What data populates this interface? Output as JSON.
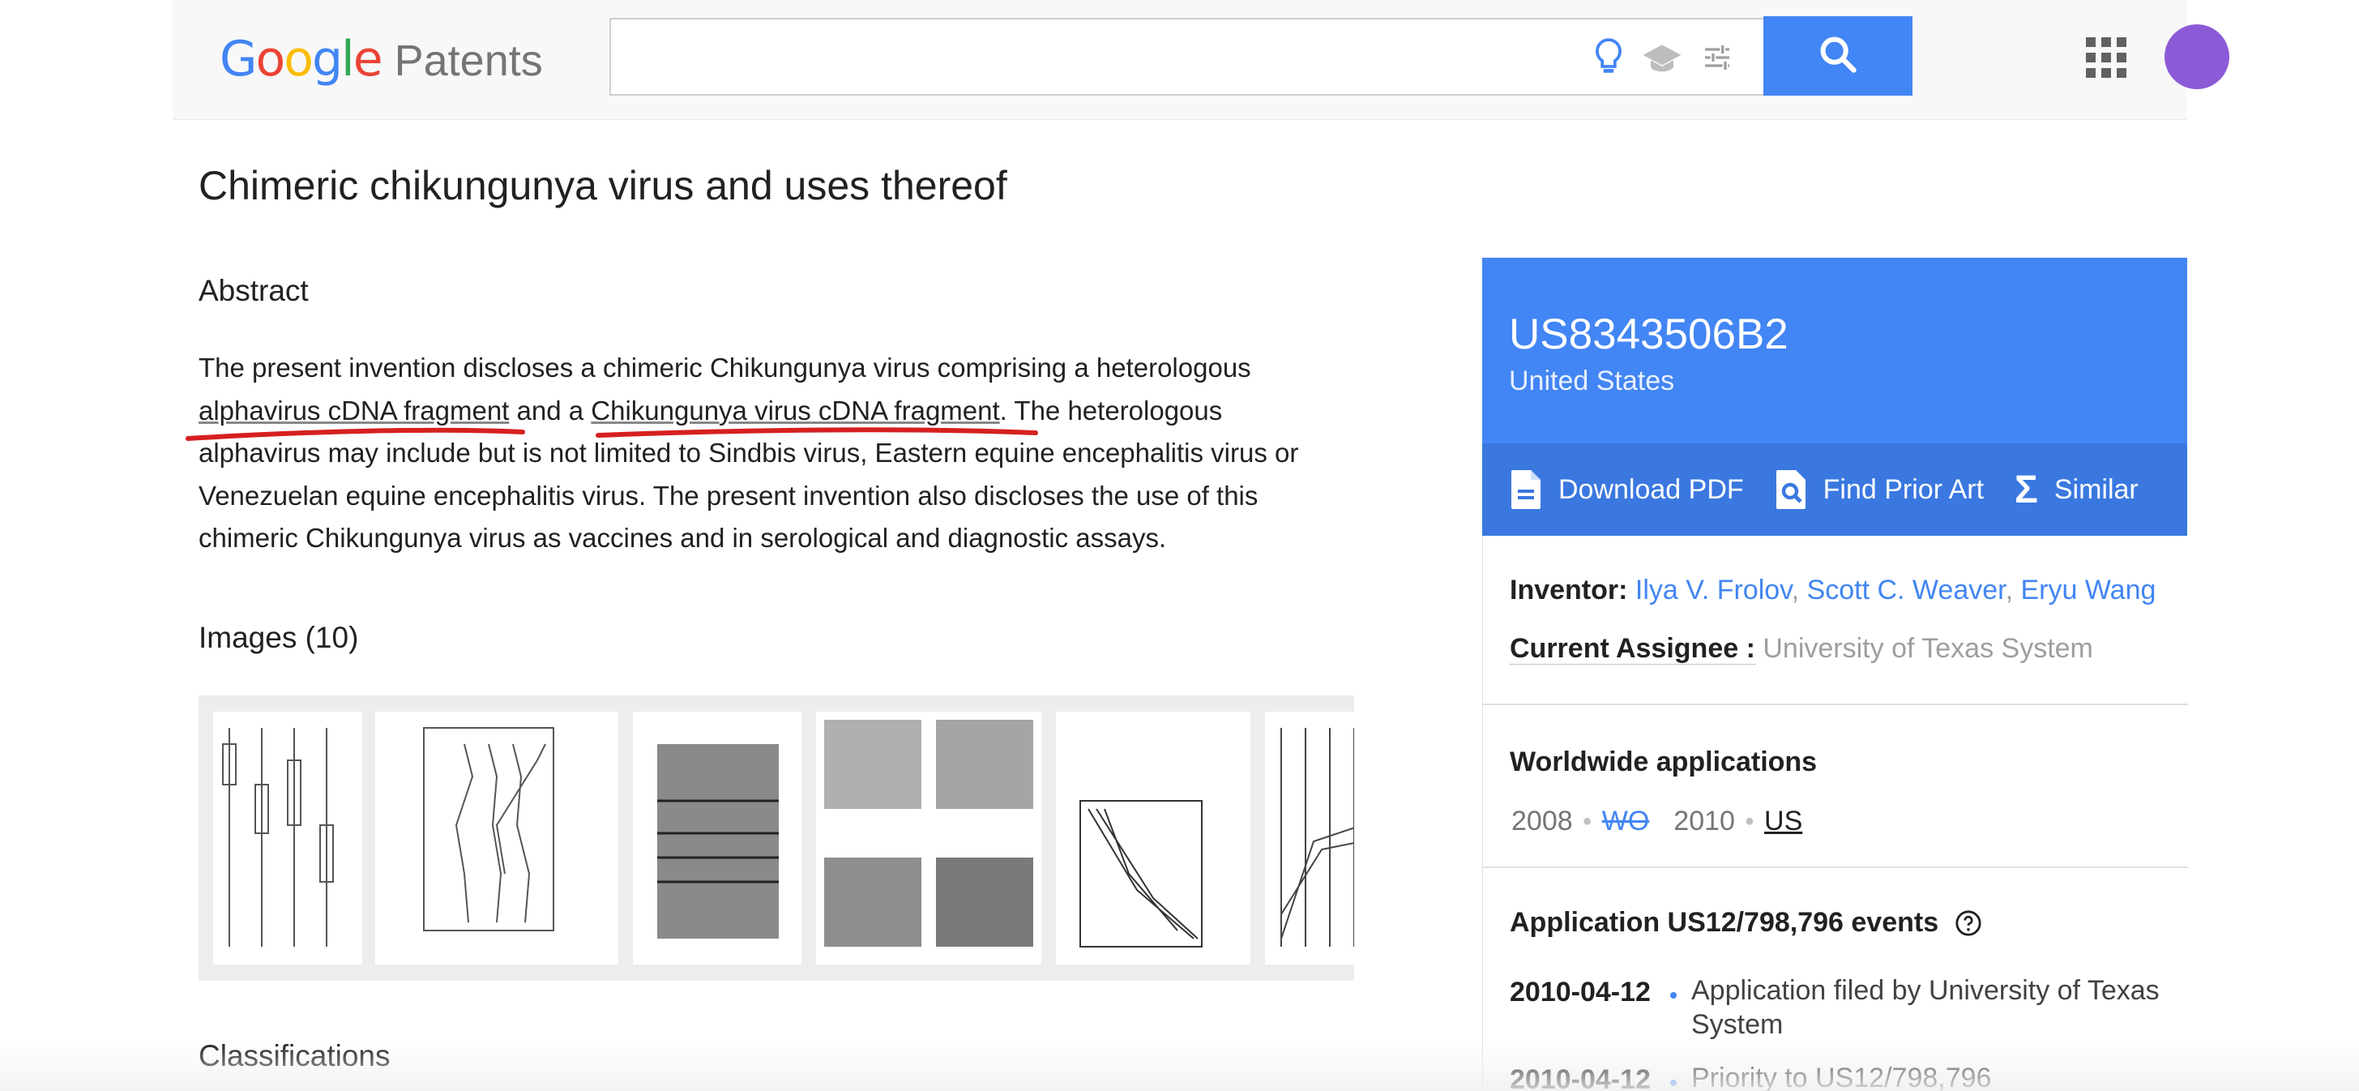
{
  "header": {
    "logo_word": "Google",
    "logo_product": "Patents",
    "search_placeholder": "",
    "colors": {
      "blue": "#4285f4",
      "red": "#ea4335",
      "yellow": "#fbbc05",
      "green": "#34a853"
    }
  },
  "patent": {
    "title": "Chimeric chikungunya virus and uses thereof",
    "abstract_heading": "Abstract",
    "abstract_parts": [
      "The present invention discloses a chimeric Chikungunya virus comprising a heterologous ",
      "alphavirus cDNA fragment",
      " and a ",
      "Chikungunya virus cDNA fragment",
      ". The heterologous alphavirus may include but is not limited to Sindbis virus, Eastern equine encephalitis virus or Venezuelan equine encephalitis virus. The present invention also discloses the use of this chimeric Chikungunya virus as vaccines and in serological and diagnostic assays."
    ],
    "images_heading": "Images (10)",
    "classifications_heading": "Classifications"
  },
  "panel": {
    "pub_number": "US8343506B2",
    "country": "United States",
    "actions": {
      "download": "Download PDF",
      "prior_art": "Find Prior Art",
      "similar": "Similar"
    },
    "inventor_label": "Inventor:",
    "inventors": [
      "Ilya V. Frolov",
      "Scott C. Weaver",
      "Eryu Wang"
    ],
    "assignee_label": "Current Assignee :",
    "assignee": "University of Texas System",
    "worldwide_heading": "Worldwide applications",
    "worldwide": [
      {
        "year": "2008",
        "country": "WO"
      },
      {
        "year": "2010",
        "country": "US"
      }
    ],
    "events_heading": "Application US12/798,796 events",
    "events": [
      {
        "date": "2010-04-12",
        "text": "Application filed by University of Texas System"
      },
      {
        "date": "2010-04-12",
        "text": "Priority to US12/798,796"
      }
    ]
  }
}
